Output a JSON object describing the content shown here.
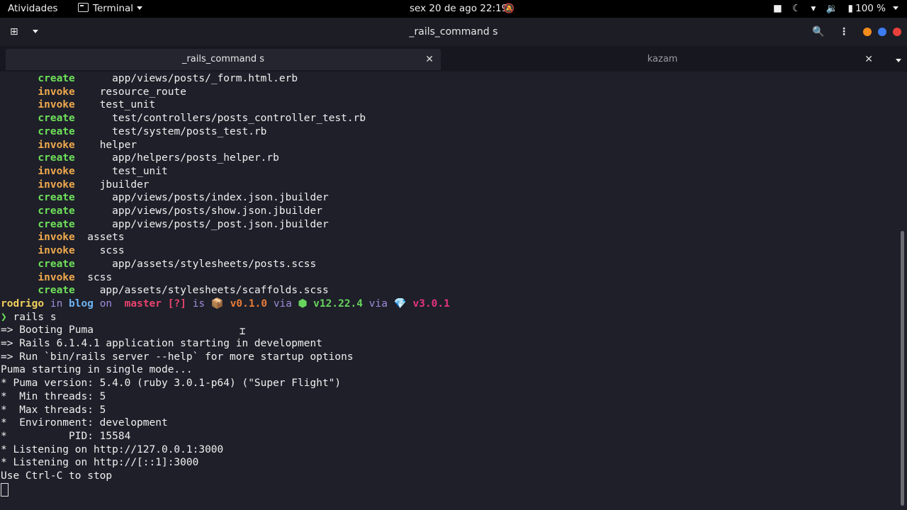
{
  "topbar": {
    "activities": "Atividades",
    "app_menu": "Terminal",
    "clock": "sex 20 de ago  22:19",
    "battery": "100 %",
    "tray_icons": [
      "camera-icon",
      "night-light-icon",
      "wifi-icon",
      "volume-icon",
      "battery-icon",
      "chevron-down-icon"
    ]
  },
  "window": {
    "title": "_rails_command s"
  },
  "tabs": [
    {
      "label": "_rails_command s",
      "active": true
    },
    {
      "label": "kazam",
      "active": false
    }
  ],
  "terminal": {
    "generator_lines": [
      {
        "action": "create",
        "indent": "      ",
        "path": "app/views/posts/_form.html.erb"
      },
      {
        "action": "invoke",
        "indent": "    ",
        "path": "resource_route"
      },
      {
        "action": "invoke",
        "indent": "    ",
        "path": "test_unit"
      },
      {
        "action": "create",
        "indent": "      ",
        "path": "test/controllers/posts_controller_test.rb"
      },
      {
        "action": "create",
        "indent": "      ",
        "path": "test/system/posts_test.rb"
      },
      {
        "action": "invoke",
        "indent": "    ",
        "path": "helper"
      },
      {
        "action": "create",
        "indent": "      ",
        "path": "app/helpers/posts_helper.rb"
      },
      {
        "action": "invoke",
        "indent": "      ",
        "path": "test_unit"
      },
      {
        "action": "invoke",
        "indent": "    ",
        "path": "jbuilder"
      },
      {
        "action": "create",
        "indent": "      ",
        "path": "app/views/posts/index.json.jbuilder"
      },
      {
        "action": "create",
        "indent": "      ",
        "path": "app/views/posts/show.json.jbuilder"
      },
      {
        "action": "create",
        "indent": "      ",
        "path": "app/views/posts/_post.json.jbuilder"
      },
      {
        "action": "invoke",
        "indent": "  ",
        "path": "assets"
      },
      {
        "action": "invoke",
        "indent": "    ",
        "path": "scss"
      },
      {
        "action": "create",
        "indent": "      ",
        "path": "app/assets/stylesheets/posts.scss"
      },
      {
        "action": "invoke",
        "indent": "  ",
        "path": "scss"
      },
      {
        "action": "create",
        "indent": "    ",
        "path": "app/assets/stylesheets/scaffolds.scss"
      }
    ],
    "prompt": {
      "user": "rodrigo",
      "in": "in",
      "dir": "blog",
      "on": "on",
      "branch_symbol": "",
      "branch": "master",
      "status": "[?]",
      "is": "is",
      "pkg_icon": "📦",
      "pkg_version": "v0.1.0",
      "via1": "via",
      "node_icon": "⬢",
      "node_version": "v12.22.4",
      "via2": "via",
      "ruby_icon": "💎",
      "ruby_version": "v3.0.1",
      "symbol": "❯",
      "command": "rails s"
    },
    "output_lines": [
      "=> Booting Puma",
      "=> Rails 6.1.4.1 application starting in development",
      "=> Run `bin/rails server --help` for more startup options",
      "Puma starting in single mode...",
      "* Puma version: 5.4.0 (ruby 3.0.1-p64) (\"Super Flight\")",
      "*  Min threads: 5",
      "*  Max threads: 5",
      "*  Environment: development",
      "*          PID: 15584",
      "* Listening on http://127.0.0.1:3000",
      "* Listening on http://[::1]:3000",
      "Use Ctrl-C to stop"
    ]
  }
}
